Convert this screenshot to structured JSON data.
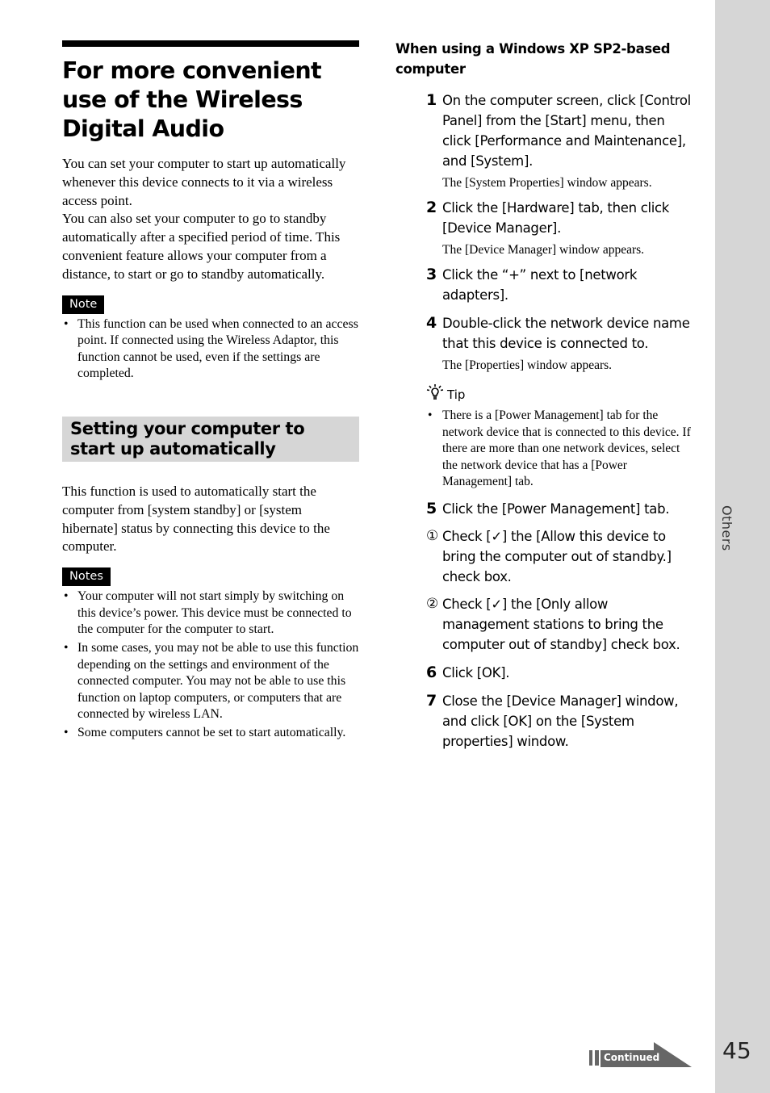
{
  "left": {
    "title": "For more convenient use of the Wireless Digital Audio",
    "intro": "You can set your computer to start up automatically whenever this device connects to it via a wireless access point.",
    "intro2": "You can also set your computer to go to standby automatically after a specified period of time. This convenient feature allows your computer from a distance, to start or go to standby automatically.",
    "note_label": "Note",
    "note_items": [
      "This function can be used when connected to an access point. If connected using the Wireless Adaptor, this function cannot be used, even if the settings are completed."
    ],
    "section_title": "Setting your computer to start up automatically",
    "section_body": "This function is used to automatically start the computer from [system standby] or [system hibernate] status by connecting this device to the computer.",
    "notes_label": "Notes",
    "notes_items": [
      "Your computer will not start simply by switching on this device’s power. This device must be connected to the computer for the computer to start.",
      "In some cases, you may not be able to use this function depending on the settings and environment of the connected computer. You may not be able to use this function on laptop computers, or computers that are connected by wireless LAN.",
      "Some computers cannot be set to start automatically."
    ]
  },
  "right": {
    "subheading": "When using a Windows XP SP2-based computer",
    "steps": [
      {
        "num": "1",
        "text": "On the computer screen, click [Control Panel] from the [Start] menu, then click [Performance and Maintenance], and [System].",
        "result": "The [System Properties] window appears."
      },
      {
        "num": "2",
        "text": "Click the [Hardware] tab, then click [Device Manager].",
        "result": "The [Device Manager] window appears."
      },
      {
        "num": "3",
        "text": "Click the “+” next to [network adapters]."
      },
      {
        "num": "4",
        "text": "Double-click the network device name that this device is connected to.",
        "result": "The [Properties] window appears."
      },
      {
        "num": "5",
        "text": "Click the [Power Management] tab."
      },
      {
        "num": "6",
        "text": "Click [OK]."
      },
      {
        "num": "7",
        "text": "Close the [Device Manager] window, and click [OK] on the [System properties] window."
      }
    ],
    "tip_label": "Tip",
    "tip_items": [
      "There is a [Power Management] tab for the network device that is connected to this device. If there are more than one network devices, select the network device that has a [Power Management] tab."
    ],
    "substeps": [
      {
        "marker": "①",
        "text": "Check [✓] the [Allow this device to bring the computer out of standby.] check box."
      },
      {
        "marker": "②",
        "text": "Check [✓] the [Only allow management stations to bring the computer out of standby] check box."
      }
    ]
  },
  "side_tab": "Others",
  "continued": "Continued",
  "page_number": "45"
}
